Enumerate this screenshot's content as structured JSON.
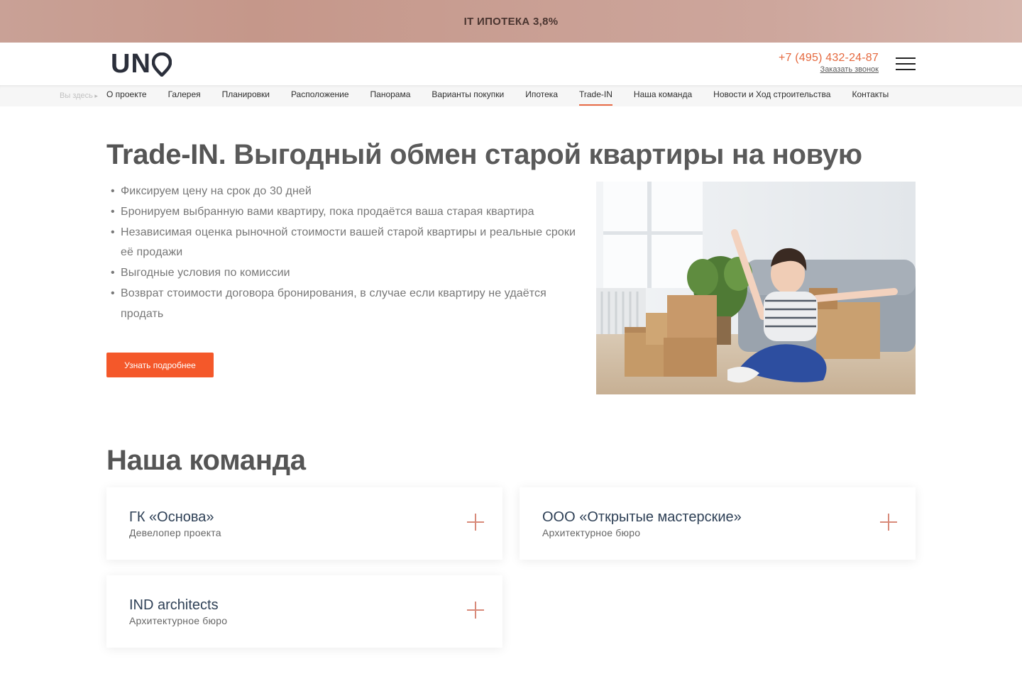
{
  "promo": {
    "text": "IT ИПОТЕКА 3,8%"
  },
  "header": {
    "logo_text": "UN",
    "phone": "+7 (495) 432-24-87",
    "callback_label": "Заказать звонок"
  },
  "nav": {
    "you_are_here": "Вы здесь",
    "items": [
      {
        "label": "О проекте"
      },
      {
        "label": "Галерея"
      },
      {
        "label": "Планировки"
      },
      {
        "label": "Расположение"
      },
      {
        "label": "Панорама"
      },
      {
        "label": "Варианты покупки"
      },
      {
        "label": "Ипотека"
      },
      {
        "label": "Trade-IN",
        "active": true
      },
      {
        "label": "Наша команда"
      },
      {
        "label": "Новости и Ход строительства"
      },
      {
        "label": "Контакты"
      }
    ]
  },
  "trade_in": {
    "title_bold": "Trade-IN",
    "title_rest": ". Выгодный обмен старой квартиры на новую",
    "benefits": [
      "Фиксируем цену на срок до 30 дней",
      "Бронируем выбранную вами квартиру, пока продаётся ваша старая квартира",
      "Независимая оценка рыночной стоимости вашей старой квартиры и реальные сроки её продажи",
      "Выгодные условия по комиссии",
      "Возврат стоимости договора бронирования, в случае если квартиру не удаётся продать"
    ],
    "cta_label": "Узнать подробнее"
  },
  "team": {
    "title": "Наша команда",
    "members": [
      {
        "name": "ГК «Основа»",
        "role": "Девелопер проекта"
      },
      {
        "name": "ООО «Открытые мастерские»",
        "role": "Архитектурное бюро"
      },
      {
        "name": "IND architects",
        "role": "Архитектурное бюро"
      }
    ]
  },
  "colors": {
    "accent": "#f4582a",
    "phone": "#e5683e",
    "plus_icon": "#d88a7a",
    "promo_bg": "#c5978a",
    "card_title": "#2e4056"
  }
}
